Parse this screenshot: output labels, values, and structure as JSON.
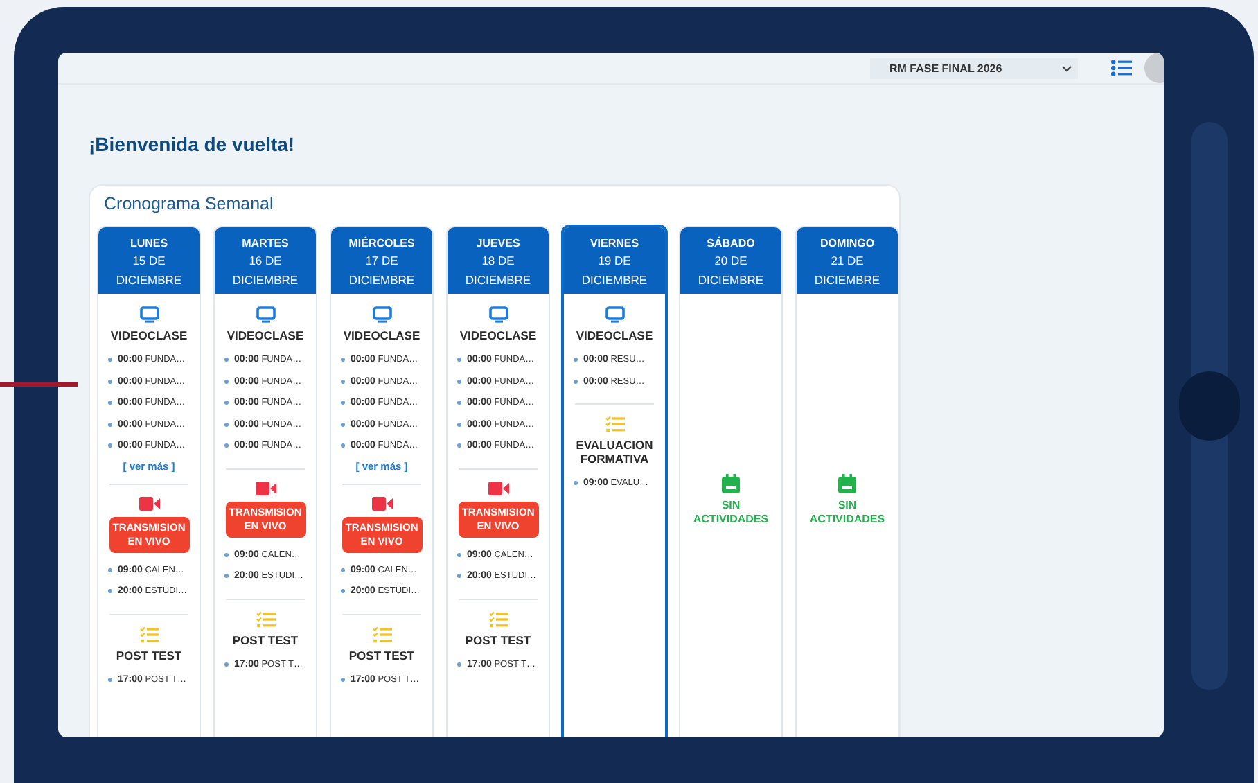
{
  "topbar": {
    "program_select": {
      "value": "RM FASE FINAL 2026"
    }
  },
  "greeting": "¡Bienvenida de vuelta!",
  "schedule": {
    "title": "Cronograma Semanal",
    "days": [
      {
        "weekday": "LUNES",
        "date": "15 DE",
        "month": "DICIEMBRE",
        "selected": false,
        "sections": [
          {
            "kind": "video",
            "title": "VIDEOCLASE",
            "items": [
              {
                "time": "00:00",
                "text": "FUNDA…"
              },
              {
                "time": "00:00",
                "text": "FUNDA…"
              },
              {
                "time": "00:00",
                "text": "FUNDA…"
              },
              {
                "time": "00:00",
                "text": "FUNDA…"
              },
              {
                "time": "00:00",
                "text": "FUNDA…"
              }
            ],
            "more": "[ ver más ]"
          },
          {
            "kind": "live",
            "title": "TRANSMISION EN VIVO",
            "items": [
              {
                "time": "09:00",
                "text": "CALEN…"
              },
              {
                "time": "20:00",
                "text": "ESTUDI…"
              }
            ]
          },
          {
            "kind": "test",
            "title": "POST TEST",
            "items": [
              {
                "time": "17:00",
                "text": "POST T…"
              }
            ]
          }
        ]
      },
      {
        "weekday": "MARTES",
        "date": "16 DE",
        "month": "DICIEMBRE",
        "selected": false,
        "sections": [
          {
            "kind": "video",
            "title": "VIDEOCLASE",
            "items": [
              {
                "time": "00:00",
                "text": "FUNDA…"
              },
              {
                "time": "00:00",
                "text": "FUNDA…"
              },
              {
                "time": "00:00",
                "text": "FUNDA…"
              },
              {
                "time": "00:00",
                "text": "FUNDA…"
              },
              {
                "time": "00:00",
                "text": "FUNDA…"
              }
            ]
          },
          {
            "kind": "live",
            "title": "TRANSMISION EN VIVO",
            "items": [
              {
                "time": "09:00",
                "text": "CALEN…"
              },
              {
                "time": "20:00",
                "text": "ESTUDI…"
              }
            ]
          },
          {
            "kind": "test",
            "title": "POST TEST",
            "items": [
              {
                "time": "17:00",
                "text": "POST T…"
              }
            ]
          }
        ]
      },
      {
        "weekday": "MIÉRCOLES",
        "date": "17 DE",
        "month": "DICIEMBRE",
        "selected": false,
        "sections": [
          {
            "kind": "video",
            "title": "VIDEOCLASE",
            "items": [
              {
                "time": "00:00",
                "text": "FUNDA…"
              },
              {
                "time": "00:00",
                "text": "FUNDA…"
              },
              {
                "time": "00:00",
                "text": "FUNDA…"
              },
              {
                "time": "00:00",
                "text": "FUNDA…"
              },
              {
                "time": "00:00",
                "text": "FUNDA…"
              }
            ],
            "more": "[ ver más ]"
          },
          {
            "kind": "live",
            "title": "TRANSMISION EN VIVO",
            "items": [
              {
                "time": "09:00",
                "text": "CALEN…"
              },
              {
                "time": "20:00",
                "text": "ESTUDI…"
              }
            ]
          },
          {
            "kind": "test",
            "title": "POST TEST",
            "items": [
              {
                "time": "17:00",
                "text": "POST T…"
              }
            ]
          }
        ]
      },
      {
        "weekday": "JUEVES",
        "date": "18 DE",
        "month": "DICIEMBRE",
        "selected": false,
        "sections": [
          {
            "kind": "video",
            "title": "VIDEOCLASE",
            "items": [
              {
                "time": "00:00",
                "text": "FUNDA…"
              },
              {
                "time": "00:00",
                "text": "FUNDA…"
              },
              {
                "time": "00:00",
                "text": "FUNDA…"
              },
              {
                "time": "00:00",
                "text": "FUNDA…"
              },
              {
                "time": "00:00",
                "text": "FUNDA…"
              }
            ]
          },
          {
            "kind": "live",
            "title": "TRANSMISION EN VIVO",
            "items": [
              {
                "time": "09:00",
                "text": "CALEN…"
              },
              {
                "time": "20:00",
                "text": "ESTUDI…"
              }
            ]
          },
          {
            "kind": "test",
            "title": "POST TEST",
            "items": [
              {
                "time": "17:00",
                "text": "POST T…"
              }
            ]
          }
        ]
      },
      {
        "weekday": "VIERNES",
        "date": "19 DE",
        "month": "DICIEMBRE",
        "selected": true,
        "sections": [
          {
            "kind": "video",
            "title": "VIDEOCLASE",
            "items": [
              {
                "time": "00:00",
                "text": "RESU…"
              },
              {
                "time": "00:00",
                "text": "RESU…"
              }
            ]
          },
          {
            "kind": "test",
            "title": "EVALUACION FORMATIVA",
            "items": [
              {
                "time": "09:00",
                "text": "EVALU…"
              }
            ]
          }
        ]
      },
      {
        "weekday": "SÁBADO",
        "date": "20 DE",
        "month": "DICIEMBRE",
        "selected": false,
        "sections": [
          {
            "kind": "empty",
            "title": "SIN ACTIVIDADES"
          }
        ]
      },
      {
        "weekday": "DOMINGO",
        "date": "21 DE",
        "month": "DICIEMBRE",
        "selected": false,
        "sections": [
          {
            "kind": "empty",
            "title": "SIN ACTIVIDADES"
          }
        ]
      }
    ]
  }
}
